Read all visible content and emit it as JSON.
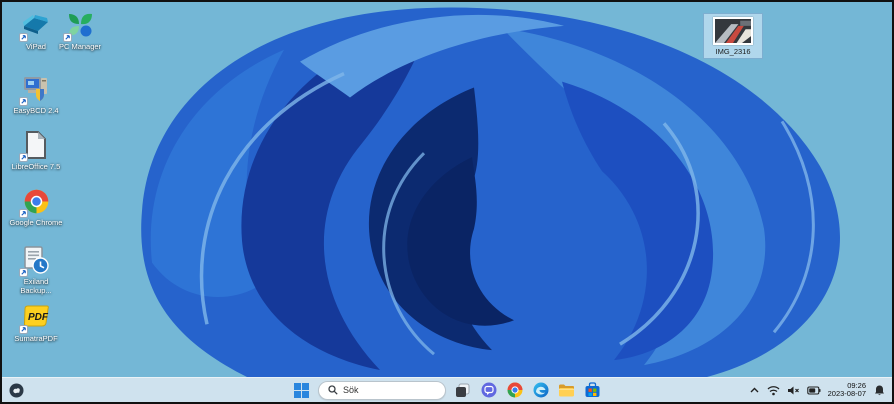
{
  "wallpaper": {
    "name": "Windows 11 Bloom (blue)",
    "background_color": "#74b7d6",
    "bloom_colors": [
      "#0a2464",
      "#15399a",
      "#2663cc",
      "#3f86da",
      "#5a9ce2",
      "#7fb6ea"
    ]
  },
  "desktop": {
    "icons": [
      {
        "label": "ViPad",
        "icon": "vipad-icon",
        "shortcut": true
      },
      {
        "label": "PC Manager",
        "icon": "pc-manager-icon",
        "shortcut": true
      },
      {
        "label": "EasyBCD 2.4",
        "icon": "easybcd-icon",
        "shortcut": true
      },
      {
        "label": "LibreOffice 7.5",
        "icon": "libreoffice-icon",
        "shortcut": true
      },
      {
        "label": "Google Chrome",
        "icon": "chrome-icon",
        "shortcut": true
      },
      {
        "label": "Exiland Backup...",
        "icon": "exiland-backup-icon",
        "shortcut": true
      },
      {
        "label": "SumatraPDF",
        "icon": "sumatrapdf-icon",
        "shortcut": true
      }
    ],
    "selected_file": {
      "label": "IMG_2316",
      "type": "image-thumbnail",
      "selected": true
    }
  },
  "taskbar": {
    "widgets_button": {
      "icon": "weather-widget-icon"
    },
    "start_button": {
      "icon": "windows-start-icon"
    },
    "search": {
      "placeholder": "Sök",
      "icon": "search-icon"
    },
    "app_buttons": [
      {
        "name": "task-view"
      },
      {
        "name": "chat"
      },
      {
        "name": "google-chrome"
      },
      {
        "name": "microsoft-edge"
      },
      {
        "name": "file-explorer"
      },
      {
        "name": "microsoft-store"
      }
    ],
    "tray": {
      "icons": [
        "hidden-icons-chevron",
        "wifi",
        "volume-muted",
        "battery"
      ],
      "time": "09:26",
      "date": "2023-08-07",
      "notification_icon": "bell"
    }
  },
  "colors": {
    "taskbar_bg": "#cfe2ee",
    "search_bg": "#ffffff",
    "selection_bg": "#c4e2f3",
    "sumatra_yellow": "#fdd020",
    "folder_yellow": "#ffcf4d",
    "start_blue": "#1f78d4"
  }
}
